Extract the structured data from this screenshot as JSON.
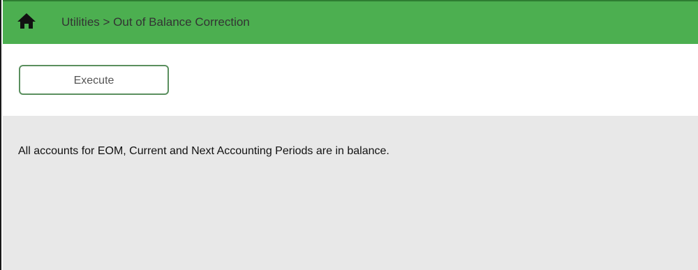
{
  "header": {
    "home_icon": "home-icon",
    "breadcrumb": "Utilities > Out of Balance Correction",
    "accent_color": "#4caf50"
  },
  "toolbar": {
    "execute_label": "Execute"
  },
  "main": {
    "message": "All accounts for EOM, Current and Next Accounting Periods are in balance."
  }
}
